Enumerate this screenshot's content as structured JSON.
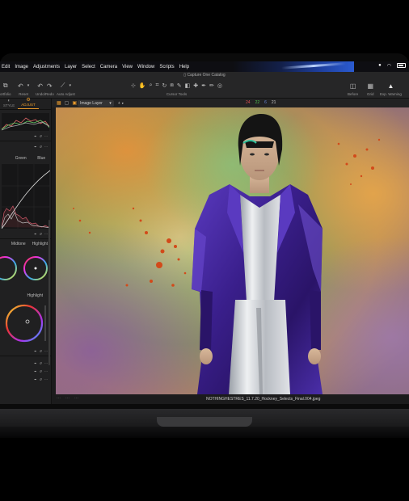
{
  "menubar": {
    "items": [
      "Edit",
      "Image",
      "Adjustments",
      "Layer",
      "Select",
      "Camera",
      "View",
      "Window",
      "Scripts",
      "Help"
    ]
  },
  "app": {
    "window_title": "Capture One Catalog"
  },
  "toolbar": {
    "left_labels": [
      "ortfolio",
      "Reset",
      "Undo/Redo",
      "Auto Adjust"
    ],
    "cursor_tools_label": "Cursor Tools",
    "right_labels": [
      "Before",
      "Grid",
      "Exp. Warning"
    ]
  },
  "left_panel": {
    "tabs": [
      "STYLE",
      "ADJUST"
    ],
    "active_tab": "ADJUST",
    "curve_channels": [
      "Green",
      "Blue"
    ],
    "wheel_labels_top": [
      "Midtone",
      "Highlight"
    ],
    "wheel_label_bottom": "Highlight"
  },
  "viewer": {
    "layer_select": "Image Layer",
    "counts": [
      {
        "value": "24",
        "color": "#e05050"
      },
      {
        "value": "22",
        "color": "#50c050"
      },
      {
        "value": "6",
        "color": "#6a8ae0"
      },
      {
        "value": "21",
        "color": "#c8c8c8"
      }
    ],
    "filename": "NOTHINGHESTRES_11.7.20_Hockney_Selects_Final.004.jpeg"
  },
  "colors": {
    "accent": "#e89a2c",
    "coat": "#3a1f8c"
  }
}
